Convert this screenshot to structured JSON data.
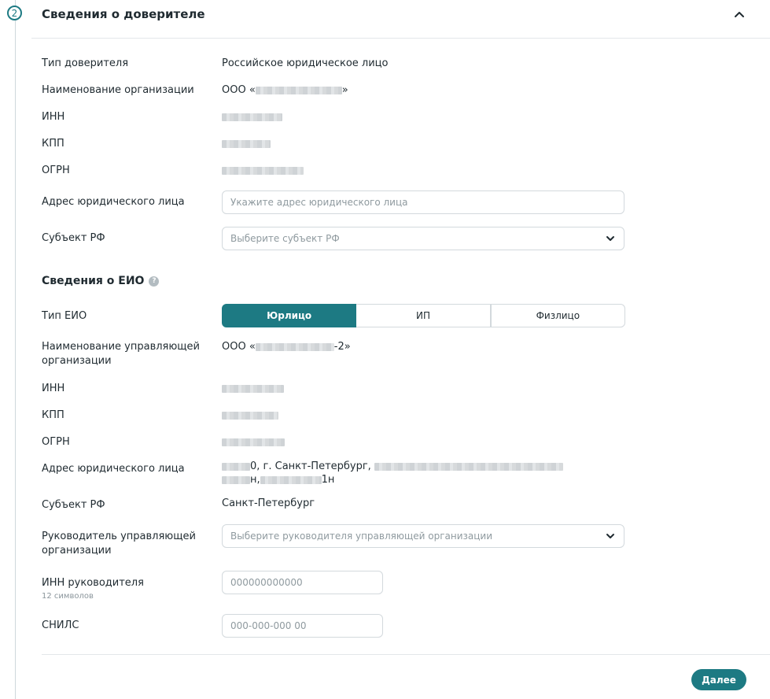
{
  "section": {
    "step_number": "2",
    "title": "Сведения о доверителе",
    "collapse_icon": "chevron-up-icon"
  },
  "principal": {
    "type_label": "Тип доверителя",
    "type_value": "Российское юридическое лицо",
    "org_name_label": "Наименование организации",
    "org_name_prefix": "ООО «",
    "org_name_suffix": "»",
    "inn_label": "ИНН",
    "kpp_label": "КПП",
    "ogrn_label": "ОГРН",
    "address_label": "Адрес юридического лица",
    "address_placeholder": "Укажите адрес юридического лица",
    "region_label": "Субъект РФ",
    "region_placeholder": "Выберите субъект РФ"
  },
  "eio": {
    "title": "Сведения о ЕИО",
    "help_icon": "question-icon",
    "type_label": "Тип ЕИО",
    "type_options": [
      "Юрлицо",
      "ИП",
      "Физлицо"
    ],
    "type_selected": "Юрлицо",
    "mgmt_org_label": "Наименование управляющей организации",
    "mgmt_org_prefix": "ООО «",
    "mgmt_org_suffix": "-2»",
    "inn_label": "ИНН",
    "kpp_label": "КПП",
    "ogrn_label": "ОГРН",
    "address_label": "Адрес юридического лица",
    "address_part1": "0, г. Санкт-Петербург,",
    "address_part2": "н,",
    "address_part3": "1н",
    "region_label": "Субъект РФ",
    "region_value": "Санкт-Петербург",
    "head_label": "Руководитель управляющей организации",
    "head_placeholder": "Выберите руководителя управляющей организации",
    "head_inn_label": "ИНН руководителя",
    "head_inn_hint": "12 символов",
    "head_inn_placeholder": "000000000000",
    "snils_label": "СНИЛС",
    "snils_placeholder": "000-000-000 00"
  },
  "actions": {
    "next_label": "Далее"
  },
  "colors": {
    "accent": "#1d7a83",
    "border": "#d3d9dd",
    "placeholder": "#8f9a9f"
  }
}
